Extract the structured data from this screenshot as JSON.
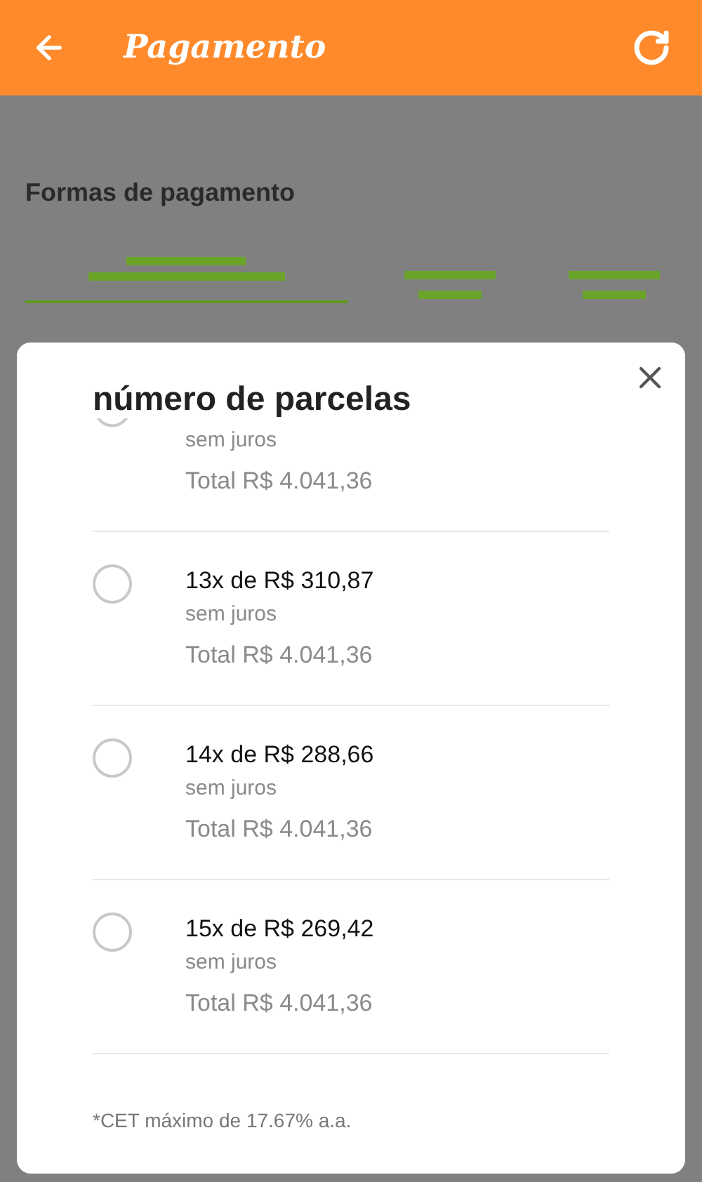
{
  "header": {
    "title": "Pagamento"
  },
  "background": {
    "section_title": "Formas de pagamento"
  },
  "modal": {
    "title": "número de parcelas",
    "partial_option": {
      "detail": "sem juros",
      "total": "Total R$ 4.041,36"
    },
    "options": [
      {
        "selected": false,
        "label": "13x de R$ 310,87",
        "detail": "sem juros",
        "total": "Total R$ 4.041,36"
      },
      {
        "selected": false,
        "label": "14x de R$ 288,66",
        "detail": "sem juros",
        "total": "Total R$ 4.041,36"
      },
      {
        "selected": false,
        "label": "15x de R$ 269,42",
        "detail": "sem juros",
        "total": "Total R$ 4.041,36"
      }
    ],
    "footnote": "*CET máximo de 17.67% a.a."
  }
}
